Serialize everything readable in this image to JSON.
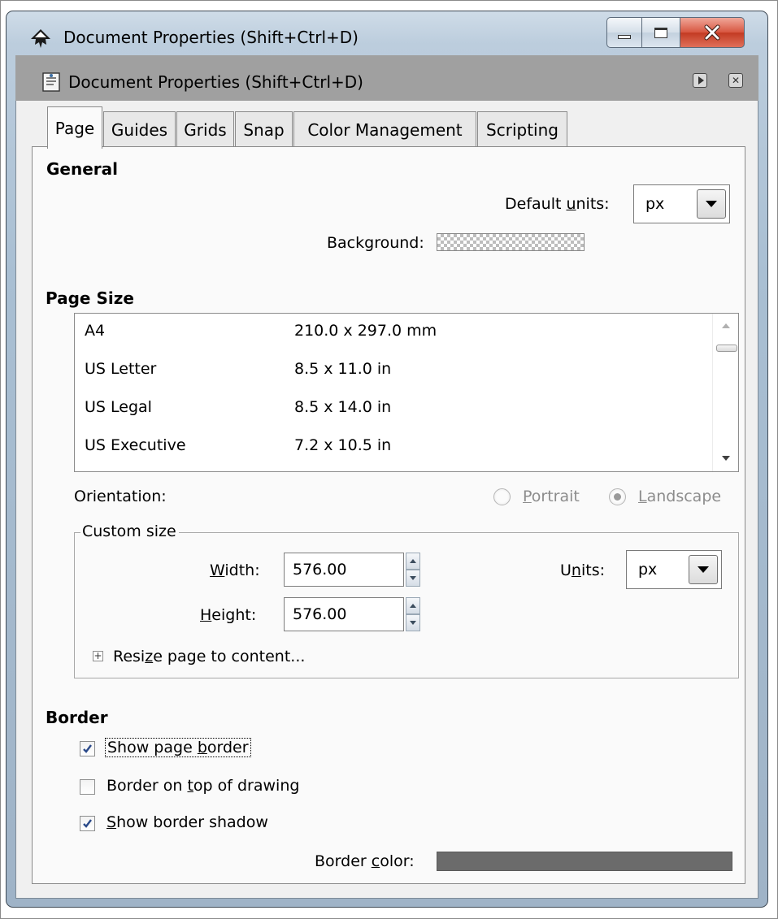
{
  "window": {
    "title": "Document Properties (Shift+Ctrl+D)",
    "controls": {
      "minimize": "minimize",
      "maximize": "maximize",
      "close": "close"
    }
  },
  "dock": {
    "title": "Document Properties (Shift+Ctrl+D)"
  },
  "tabs": [
    "Page",
    "Guides",
    "Grids",
    "Snap",
    "Color Management",
    "Scripting"
  ],
  "active_tab": "Page",
  "general": {
    "title": "General",
    "default_units_pre": "Default ",
    "default_units_mn": "u",
    "default_units_post": "nits:",
    "default_units_value": "px",
    "background_label": "Background:"
  },
  "page_size": {
    "title": "Page Size",
    "rows": [
      {
        "name": "A4",
        "size": "210.0 x 297.0 mm"
      },
      {
        "name": "US Letter",
        "size": "8.5 x 11.0 in"
      },
      {
        "name": "US Legal",
        "size": "8.5 x 14.0 in"
      },
      {
        "name": "US Executive",
        "size": "7.2 x 10.5 in"
      }
    ],
    "orientation_label": "Orientation:",
    "portrait_mn": "P",
    "portrait_rest": "ortrait",
    "landscape_mn": "L",
    "landscape_rest": "andscape",
    "selected_orientation": "Landscape"
  },
  "custom_size": {
    "title": "Custom size",
    "width_mn": "W",
    "width_rest": "idth:",
    "width_value": "576.00",
    "height_mn": "H",
    "height_rest": "eight:",
    "height_value": "576.00",
    "units_pre": "U",
    "units_mn": "n",
    "units_post": "its:",
    "units_value": "px",
    "resize_pre": "Resi",
    "resize_mn": "z",
    "resize_post": "e page to content..."
  },
  "border": {
    "title": "Border",
    "show_page_border_pre": "Show page ",
    "show_page_border_mn": "b",
    "show_page_border_post": "order",
    "show_page_border_checked": true,
    "on_top_pre": "Border on ",
    "on_top_mn": "t",
    "on_top_post": "op of drawing",
    "on_top_checked": false,
    "shadow_mn": "S",
    "shadow_rest": "how border shadow",
    "shadow_checked": true,
    "color_pre": "Border ",
    "color_mn": "c",
    "color_post": "olor:",
    "color_value": "#6b6b6b"
  }
}
